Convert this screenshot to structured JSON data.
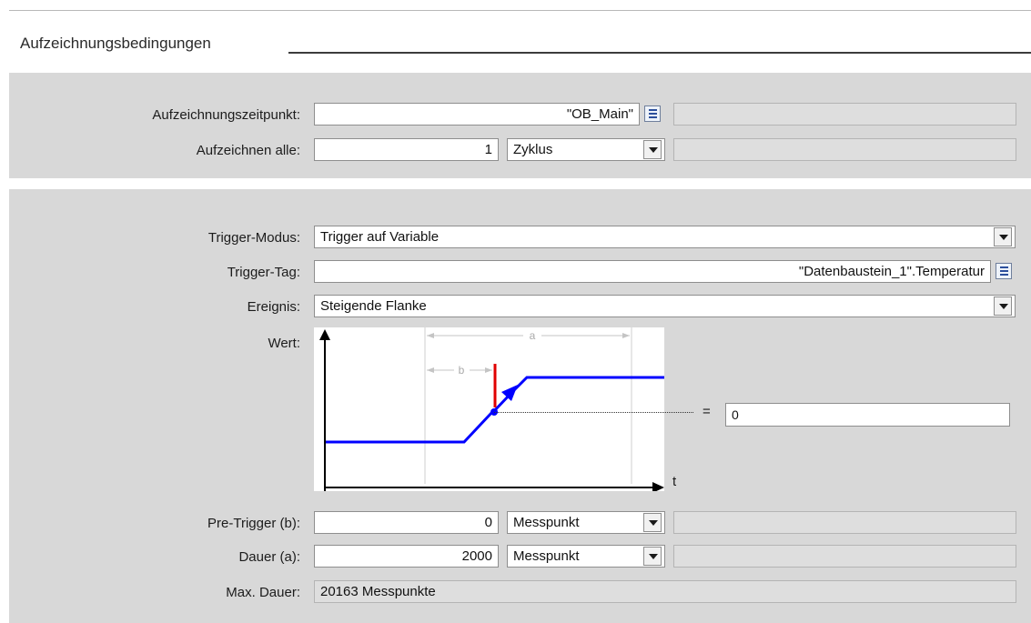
{
  "section": {
    "title": "Aufzeichnungsbedingungen"
  },
  "recording": {
    "time_label": "Aufzeichnungszeitpunkt:",
    "time_value": "\"OB_Main\"",
    "every_label": "Aufzeichnen alle:",
    "every_value": "1",
    "every_unit": "Zyklus"
  },
  "trigger": {
    "mode_label": "Trigger-Modus:",
    "mode_value": "Trigger auf  Variable",
    "tag_label": "Trigger-Tag:",
    "tag_value": "\"Datenbaustein_1\".Temperatur",
    "event_label": "Ereignis:",
    "event_value": "Steigende Flanke",
    "value_label": "Wert:",
    "compare_symbol": "=",
    "compare_value": "0"
  },
  "diagram": {
    "label_a": "a",
    "label_b": "b",
    "axis_t": "t"
  },
  "pretrigger": {
    "label": "Pre-Trigger (b):",
    "value": "0",
    "unit": "Messpunkt"
  },
  "duration": {
    "label": "Dauer (a):",
    "value": "2000",
    "unit": "Messpunkt"
  },
  "maxduration": {
    "label": "Max. Dauer:",
    "value": "20163 Messpunkte"
  },
  "icons": {
    "list": "list-icon",
    "dropdown": "chevron-down-icon"
  },
  "colors": {
    "panel": "#d8d8d8",
    "signal": "#0000ff",
    "trigger_mark": "#e00000"
  }
}
